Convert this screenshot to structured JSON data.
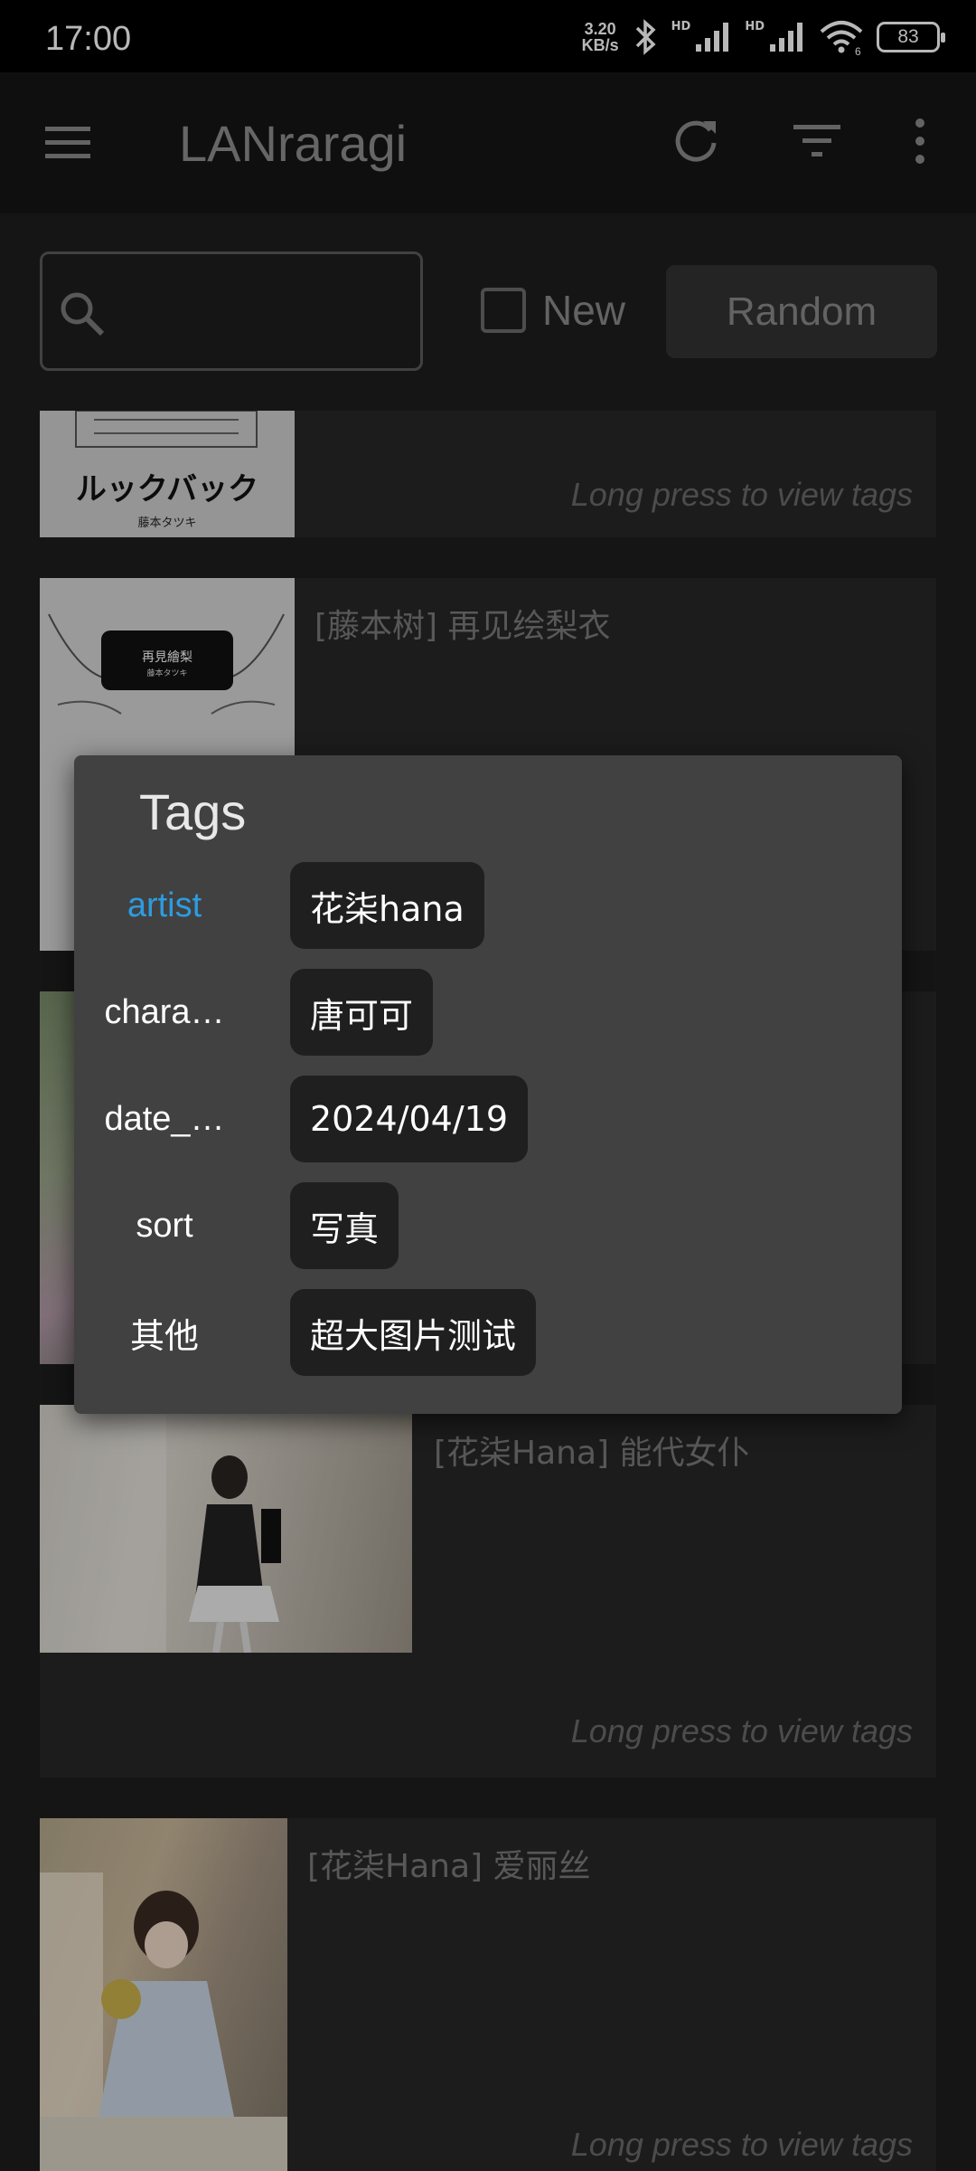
{
  "status_bar": {
    "time": "17:00",
    "net_speed_value": "3.20",
    "net_speed_unit": "KB/s",
    "hd1": "HD",
    "hd2": "HD",
    "wifi_sub": "6",
    "battery": "83"
  },
  "app_bar": {
    "title": "LANraragi",
    "icons": [
      "menu-icon",
      "refresh-icon",
      "filter-icon",
      "more-vert-icon"
    ]
  },
  "search": {
    "placeholder": "",
    "new_label": "New",
    "random_label": "Random"
  },
  "archives": [
    {
      "title": "",
      "hint": "Long press to view tags"
    },
    {
      "title": "[藤本树] 再见绘梨衣",
      "hint": ""
    },
    {
      "title": "",
      "hint": ""
    },
    {
      "title": "[花柒Hana] 能代女仆",
      "hint": "Long press to view tags"
    },
    {
      "title": "[花柒Hana] 爱丽丝",
      "hint": "Long press to view tags"
    }
  ],
  "thumb_text": {
    "lookback_title": "ルックバック",
    "lookback_author": "藤本タツキ",
    "goodbye_title": "再見繪梨",
    "goodbye_author": "藤本タツキ"
  },
  "tags_dialog": {
    "title": "Tags",
    "rows": [
      {
        "key": "artist",
        "value": "花柒hana"
      },
      {
        "key": "chara…",
        "value": "唐可可"
      },
      {
        "key": "date_…",
        "value": "2024/04/19"
      },
      {
        "key": "sort",
        "value": "写真"
      },
      {
        "key": "其他",
        "value": "超大图片测试"
      }
    ],
    "accent_color": "#2d9ce0"
  }
}
